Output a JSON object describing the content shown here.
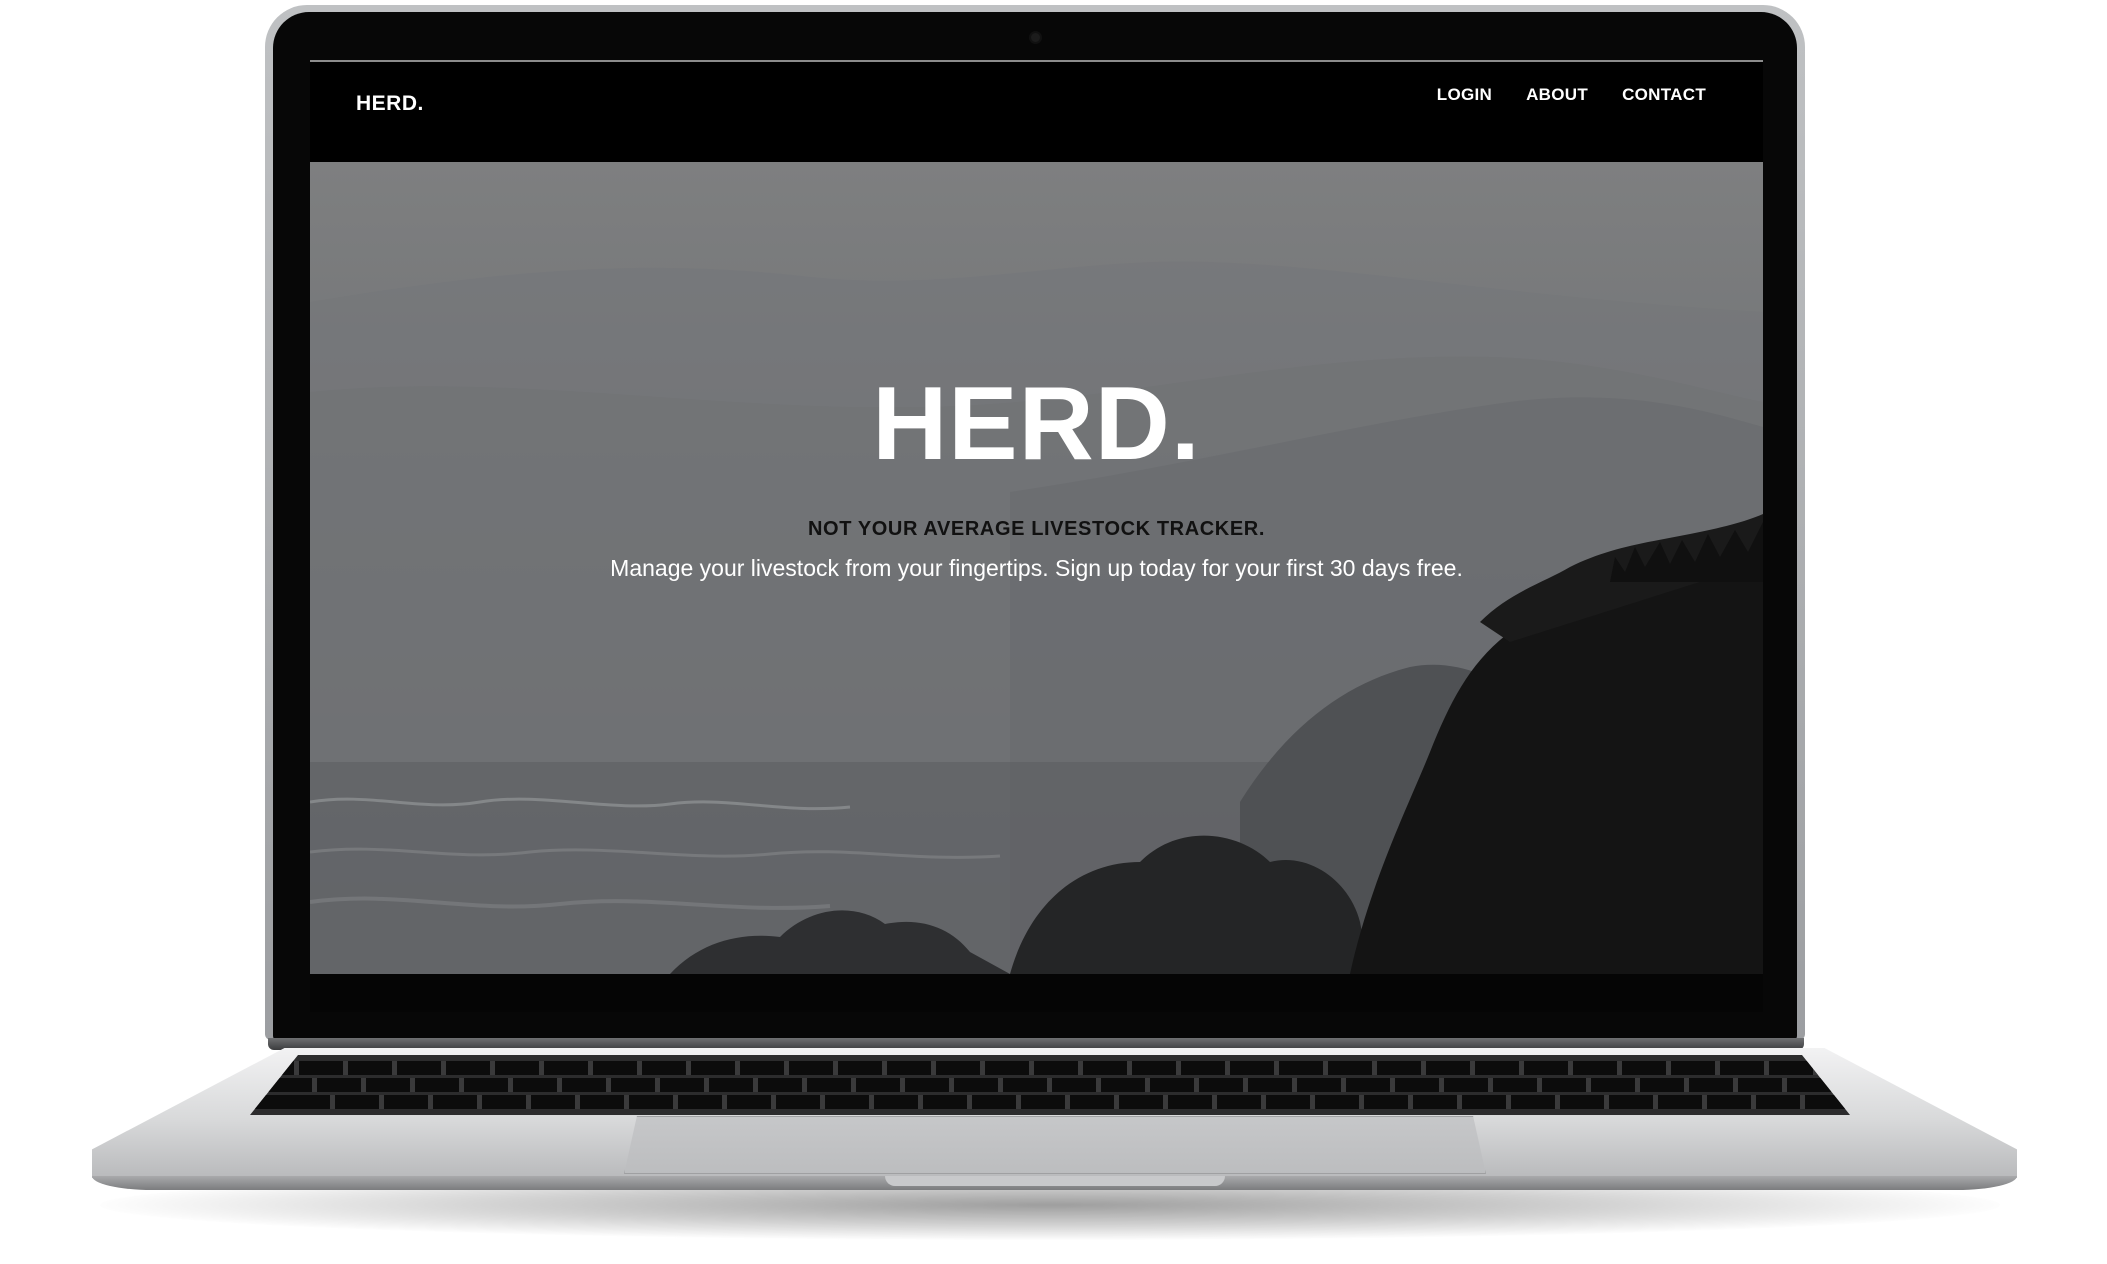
{
  "navbar": {
    "brand": "HERD.",
    "links": [
      "LOGIN",
      "ABOUT",
      "CONTACT"
    ]
  },
  "hero": {
    "title": "HERD.",
    "tagline": "NOT YOUR AVERAGE LIVESTOCK TRACKER.",
    "subtitle": "Manage your livestock from your fingertips. Sign up today for your first 30 days free."
  },
  "colors": {
    "navbar_bg": "#000000",
    "hero_overlay": "#6e7072",
    "text_light": "#ffffff",
    "text_dark": "#111111"
  }
}
